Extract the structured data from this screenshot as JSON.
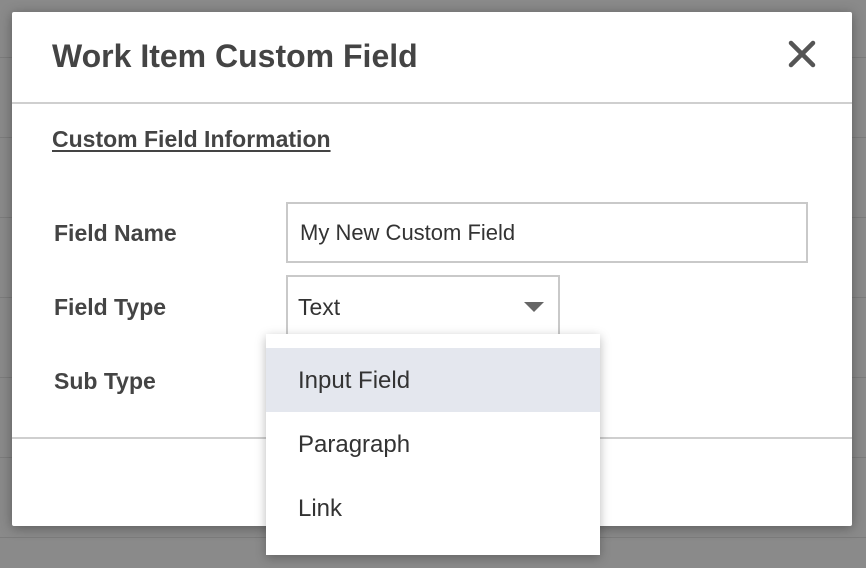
{
  "modal": {
    "title": "Work Item Custom Field",
    "close_icon": "close-icon"
  },
  "section": {
    "title": "Custom Field Information"
  },
  "fields": {
    "field_name": {
      "label": "Field Name",
      "value": "My New Custom Field"
    },
    "field_type": {
      "label": "Field Type",
      "value": "Text",
      "caret_icon": "caret-down-icon"
    },
    "sub_type": {
      "label": "Sub Type"
    }
  },
  "dropdown": {
    "items": [
      {
        "label": "Input Field",
        "highlighted": true
      },
      {
        "label": "Paragraph",
        "highlighted": false
      },
      {
        "label": "Link",
        "highlighted": false
      }
    ]
  },
  "colors": {
    "overlay": "#8a8a8a",
    "title_text": "#444444",
    "highlight": "#e4e7ee",
    "border": "#c9c9c9"
  }
}
